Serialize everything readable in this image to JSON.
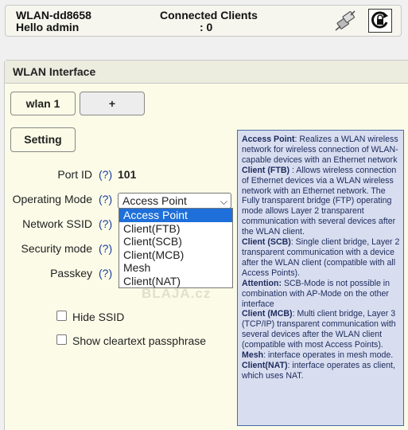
{
  "header": {
    "device_name": "WLAN-dd8658",
    "greeting": "Hello admin",
    "clients_label": "Connected Clients",
    "clients_count": ": 0"
  },
  "panel": {
    "title": "WLAN Interface",
    "tabs": [
      "wlan 1",
      "+"
    ],
    "setting_button": "Setting"
  },
  "form": {
    "port_id": {
      "label": "Port ID",
      "help": "(?)",
      "value": "101"
    },
    "operating_mode": {
      "label": "Operating Mode",
      "help": "(?)",
      "selected": "Access Point",
      "options": [
        "Access Point",
        "Client(FTB)",
        "Client(SCB)",
        "Client(MCB)",
        "Mesh",
        "Client(NAT)"
      ]
    },
    "network_ssid": {
      "label": "Network SSID",
      "help": "(?)"
    },
    "security_mode": {
      "label": "Security mode",
      "help": "(?)"
    },
    "passkey": {
      "label": "Passkey",
      "help": "(?)"
    },
    "hide_ssid": "Hide SSID",
    "show_passphrase": "Show cleartext passphrase"
  },
  "watermark": "BLAJA.cz",
  "help_text": [
    {
      "term": "Access Point",
      "desc": ": Realizes a WLAN wireless network for wireless connection of WLAN-capable devices with an Ethernet network"
    },
    {
      "term": "Client (FTB)",
      "desc": " : Allows wireless connection of Ethernet devices via a WLAN wireless network with an Ethernet network. The Fully transparent bridge (FTP) operating mode allows Layer 2 transparent communication with several devices after the WLAN client."
    },
    {
      "term": "Client (SCB)",
      "desc": ": Single client bridge, Layer 2 transparent communication with a device after the WLAN client (compatible with all Access Points)."
    },
    {
      "term": "Attention:",
      "desc": " SCB-Mode is not possible in combination with AP-Mode on the other interface"
    },
    {
      "term": "Client (MCB)",
      "desc": ": Multi client bridge, Layer 3 (TCP/IP) transparent communication with several devices after the WLAN client (compatible with most Access Points)."
    },
    {
      "term": "Mesh",
      "desc": ": interface operates in mesh mode."
    },
    {
      "term": "Client(NAT)",
      "desc": ": interface operates as client, which uses NAT."
    }
  ]
}
